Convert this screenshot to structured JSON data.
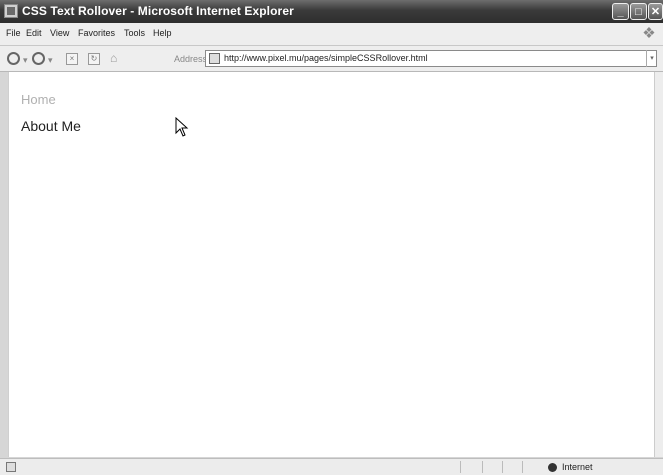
{
  "window": {
    "title": "CSS Text Rollover - Microsoft Internet Explorer",
    "controls": {
      "minimize": "_",
      "maximize": "□",
      "close": "✕"
    }
  },
  "menu": {
    "items": [
      "File",
      "Edit",
      "View",
      "Favorites",
      "Tools",
      "Help"
    ]
  },
  "toolbar": {
    "address_label": "Address",
    "address_value": "http://www.pixel.mu/pages/simpleCSSRollover.html"
  },
  "page": {
    "links": [
      {
        "label": "Home",
        "state": "hover"
      },
      {
        "label": "About Me",
        "state": "normal"
      }
    ]
  },
  "status": {
    "zone": "Internet"
  },
  "colors": {
    "title_bar": "#3a3a3a",
    "link_hover": "#b0b0b0",
    "link_normal": "#222222"
  }
}
